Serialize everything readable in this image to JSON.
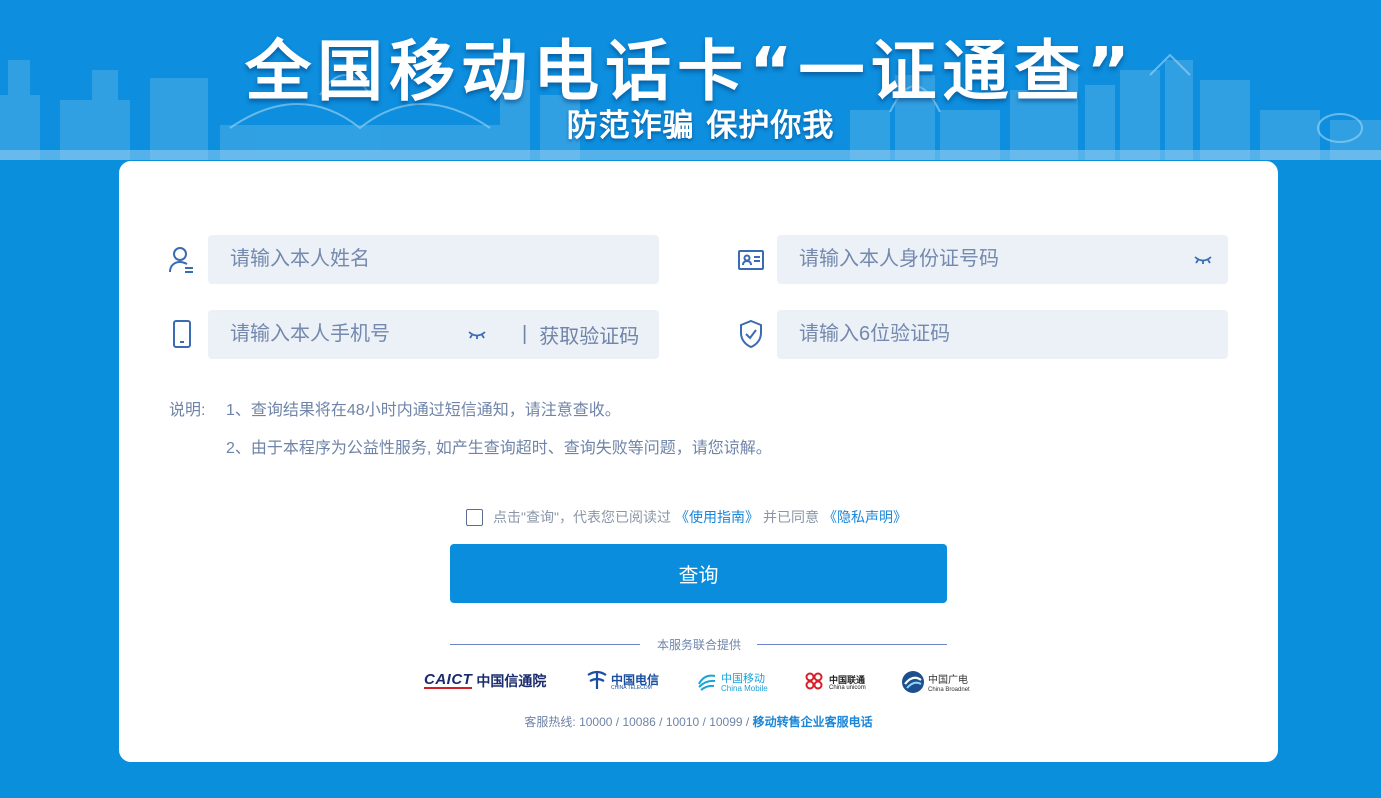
{
  "banner": {
    "title": "全国移动电话卡“一证通查”",
    "subtitle": "防范诈骗 保护你我"
  },
  "form": {
    "name_placeholder": "请输入本人姓名",
    "id_placeholder": "请输入本人身份证号码",
    "phone_placeholder": "请输入本人手机号",
    "get_code_sep": "|",
    "get_code_label": "获取验证码",
    "code_placeholder": "请输入6位验证码"
  },
  "notes": {
    "label": "说明:",
    "line1": "1、查询结果将在48小时内通过短信通知，请注意查收。",
    "line2": "2、由于本程序为公益性服务, 如产生查询超时、查询失败等问题，请您谅解。"
  },
  "agreement": {
    "text_before": "点击\"查询\"，代表您已阅读过",
    "guide_link": "《使用指南》",
    "text_middle": "并已同意",
    "privacy_link": "《隐私声明》"
  },
  "query_button": "查询",
  "providers": {
    "heading": "本服务联合提供",
    "caict": {
      "brand": "CAICT",
      "name": "中国信通院"
    },
    "telecom": {
      "name": "中国电信",
      "english": "CHINA TELECOM"
    },
    "mobile": {
      "name": "中国移动",
      "english": "China Mobile"
    },
    "unicom": {
      "name": "中国联通",
      "english": "China unicom"
    },
    "broadnet": {
      "name": "中国广电",
      "english": "China Broadnet"
    }
  },
  "hotline": {
    "text": "客服热线: 10000 / 10086 / 10010 / 10099 /",
    "link": "移动转售企业客服电话"
  },
  "colors": {
    "page_bg": "#0a8fdc",
    "accent": "#0a8ddc",
    "field_bg": "#ecf1f8",
    "text_muted": "#6f84a8",
    "link": "#1b86d9"
  },
  "icons": [
    "user-icon",
    "id-card-icon",
    "phone-icon",
    "shield-check-icon",
    "eye-closed-icon"
  ]
}
